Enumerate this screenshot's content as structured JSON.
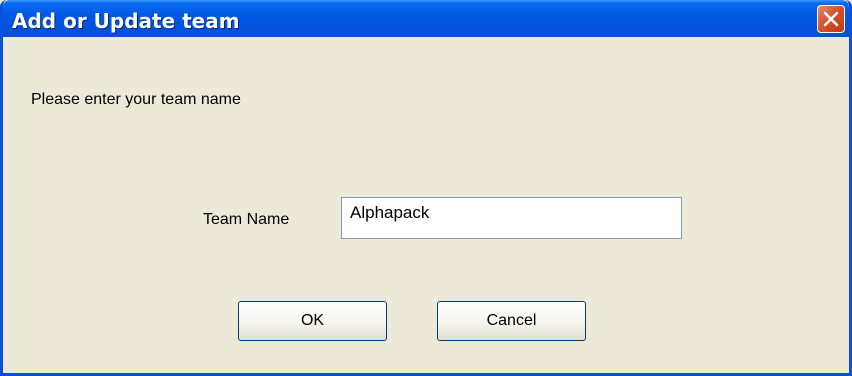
{
  "window": {
    "title": "Add or Update team",
    "close_icon": "close-icon"
  },
  "dialog": {
    "prompt": "Please enter your team name",
    "team_name_label": "Team Name",
    "team_name_value": "Alphapack",
    "ok_label": "OK",
    "cancel_label": "Cancel"
  },
  "colors": {
    "titlebar": "#0058e6",
    "window_bg": "#ece9d8",
    "close_button": "#d6512c"
  }
}
